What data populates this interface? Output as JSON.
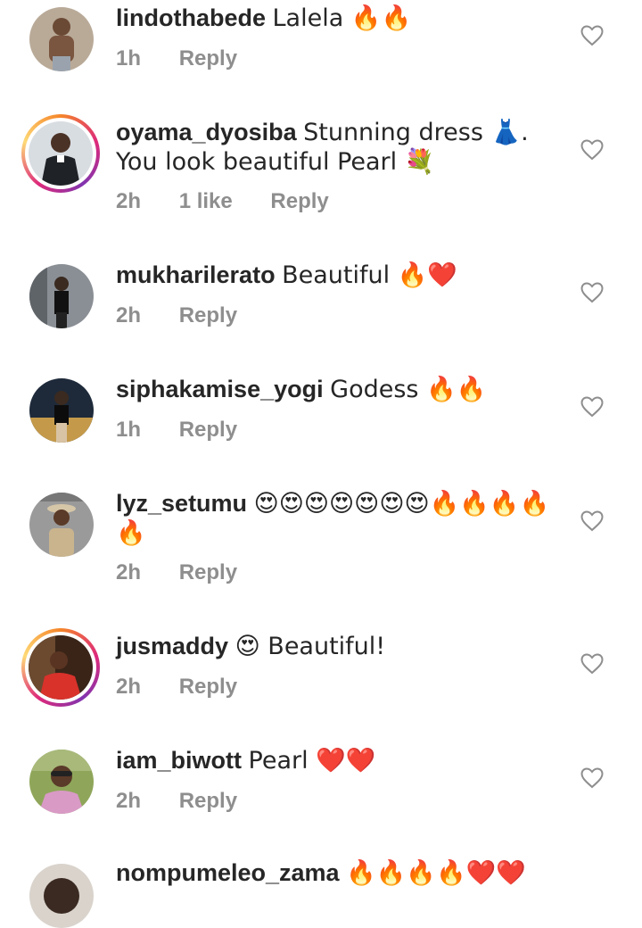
{
  "comments": [
    {
      "username": "lindothabede",
      "text": "Lalela 🔥🔥",
      "time": "1h",
      "likes": "",
      "reply": "Reply",
      "story_ring": false
    },
    {
      "username": "oyama_dyosiba",
      "text": "Stunning dress 👗. You look beautiful Pearl 💐",
      "time": "2h",
      "likes": "1 like",
      "reply": "Reply",
      "story_ring": true
    },
    {
      "username": "mukharilerato",
      "text": "Beautiful 🔥❤️",
      "time": "2h",
      "likes": "",
      "reply": "Reply",
      "story_ring": false
    },
    {
      "username": "siphakamise_yogi",
      "text": "Godess 🔥🔥",
      "time": "1h",
      "likes": "",
      "reply": "Reply",
      "story_ring": false
    },
    {
      "username": "lyz_setumu",
      "text": "😍😍😍😍😍😍😍🔥🔥🔥🔥🔥",
      "time": "2h",
      "likes": "",
      "reply": "Reply",
      "story_ring": false
    },
    {
      "username": "jusmaddy",
      "text": "😍 Beautiful!",
      "time": "2h",
      "likes": "",
      "reply": "Reply",
      "story_ring": true
    },
    {
      "username": "iam_biwott",
      "text": "Pearl ❤️❤️",
      "time": "2h",
      "likes": "",
      "reply": "Reply",
      "story_ring": false
    },
    {
      "username": "nompumeleo_zama",
      "text": "🔥🔥🔥🔥❤️❤️",
      "time": "",
      "likes": "",
      "reply": "",
      "story_ring": false
    }
  ],
  "colors": {
    "text": "#262626",
    "meta": "#8e8e8e",
    "heart_outline": "#8e8e8e"
  },
  "icons": {
    "like": "heart-outline-icon"
  }
}
